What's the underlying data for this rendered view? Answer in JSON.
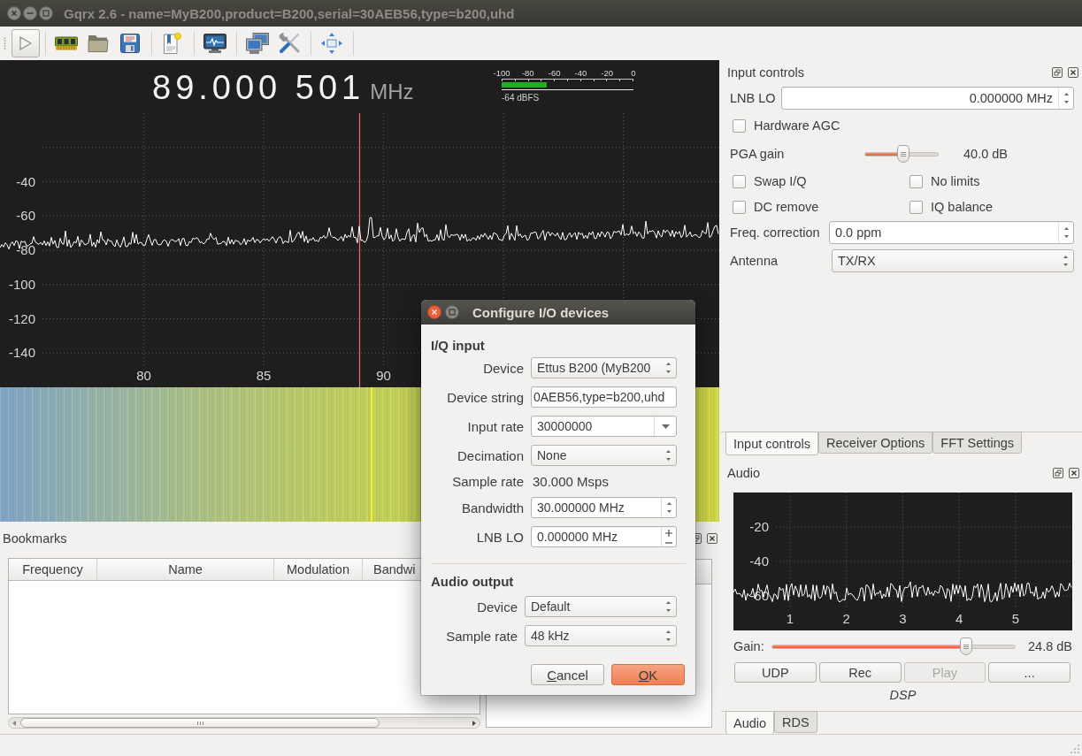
{
  "window": {
    "title": "Gqrx 2.6 - name=MyB200,product=B200,serial=30AEB56,type=b200,uhd"
  },
  "spectrum": {
    "frequency": "89.000 501",
    "unit": "MHz",
    "meter": {
      "scale": [
        "-100",
        "-80",
        "-60",
        "-40",
        "-20",
        "0"
      ],
      "level": 0.34,
      "reading": "-64 dBFS"
    },
    "y_labels": [
      "-40",
      "-60",
      "-80",
      "-100",
      "-120",
      "-140"
    ],
    "x_labels": [
      "80",
      "85",
      "90"
    ]
  },
  "input_controls": {
    "title": "Input controls",
    "lnb_lo": {
      "label": "LNB LO",
      "value": "0.000000 MHz"
    },
    "hardware_agc": {
      "label": "Hardware AGC",
      "checked": false
    },
    "pga_gain": {
      "label": "PGA gain",
      "level": 0.53,
      "reading": "40.0 dB"
    },
    "options": [
      {
        "label": "Swap I/Q",
        "checked": false
      },
      {
        "label": "No limits",
        "checked": false
      },
      {
        "label": "DC remove",
        "checked": false
      },
      {
        "label": "IQ balance",
        "checked": false
      }
    ],
    "freq_correction": {
      "label": "Freq. correction",
      "value": "0.0 ppm"
    },
    "antenna": {
      "label": "Antenna",
      "value": "TX/RX"
    }
  },
  "dock_tabs": [
    {
      "label": "Input controls",
      "selected": true
    },
    {
      "label": "Receiver Options",
      "selected": false
    },
    {
      "label": "FFT Settings",
      "selected": false
    }
  ],
  "audio": {
    "title": "Audio",
    "y_labels": [
      "-20",
      "-40",
      "-60"
    ],
    "x_labels": [
      "1",
      "2",
      "3",
      "4",
      "5"
    ],
    "gain": {
      "label": "Gain:",
      "level": 0.8,
      "reading": "24.8 dB"
    },
    "buttons": [
      {
        "label": "UDP",
        "disabled": false
      },
      {
        "label": "Rec",
        "disabled": false
      },
      {
        "label": "Play",
        "disabled": true
      },
      {
        "label": "...",
        "disabled": false
      }
    ],
    "caption": "DSP"
  },
  "bottom_tabs": [
    {
      "label": "Audio",
      "selected": true
    },
    {
      "label": "RDS",
      "selected": false
    }
  ],
  "bookmarks": {
    "title": "Bookmarks",
    "columns": [
      "Frequency",
      "Name",
      "Modulation",
      "Bandwi"
    ]
  },
  "dialog": {
    "title": "Configure I/O devices",
    "iq_input": {
      "heading": "I/Q input",
      "rows": [
        {
          "kind": "combo",
          "label": "Device",
          "value": "Ettus B200 (MyB200"
        },
        {
          "kind": "text",
          "label": "Device string",
          "value": "0AEB56,type=b200,uhd"
        },
        {
          "kind": "editable_combo",
          "label": "Input rate",
          "value": "30000000"
        },
        {
          "kind": "combo",
          "label": "Decimation",
          "value": "None"
        },
        {
          "kind": "readout",
          "label": "Sample rate",
          "value": "30.000 Msps"
        },
        {
          "kind": "spin",
          "label": "Bandwidth",
          "value": "30.000000 MHz"
        },
        {
          "kind": "plusminus",
          "label": "LNB LO",
          "value": "0.000000 MHz"
        }
      ]
    },
    "audio_output": {
      "heading": "Audio output",
      "rows": [
        {
          "kind": "combo",
          "label": "Device",
          "value": "Default"
        },
        {
          "kind": "combo",
          "label": "Sample rate",
          "value": "48 kHz"
        }
      ]
    },
    "buttons": [
      {
        "label": "Cancel",
        "default": false
      },
      {
        "label": "OK",
        "default": true
      }
    ]
  }
}
